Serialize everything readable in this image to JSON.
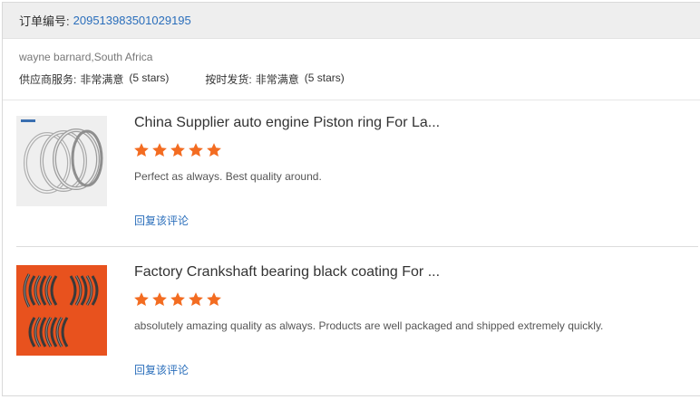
{
  "order": {
    "label": "订单编号:",
    "number": "209513983501029195"
  },
  "buyer": {
    "name_country": "wayne barnard,South Africa",
    "supplier_service_label": "供应商服务:",
    "supplier_service_value": "非常满意",
    "supplier_service_stars": "(5 stars)",
    "on_time_label": "按时发货:",
    "on_time_value": "非常满意",
    "on_time_stars": "(5 stars)"
  },
  "reviews": [
    {
      "product_title": "China Supplier auto engine Piston ring For La...",
      "rating": 5,
      "comment": "Perfect as always. Best quality around.",
      "reply_label": "回复该评论",
      "thumbnail": "piston-rings-image"
    },
    {
      "product_title": "Factory Crankshaft bearing black coating For ...",
      "rating": 5,
      "comment": "absolutely amazing quality as always. Products are well packaged and shipped extremely quickly.",
      "reply_label": "回复该评论",
      "thumbnail": "crankshaft-bearings-image"
    }
  ],
  "colors": {
    "star": "#f36c21",
    "link": "#2a6ebb",
    "header_bg": "#eeeeee"
  }
}
